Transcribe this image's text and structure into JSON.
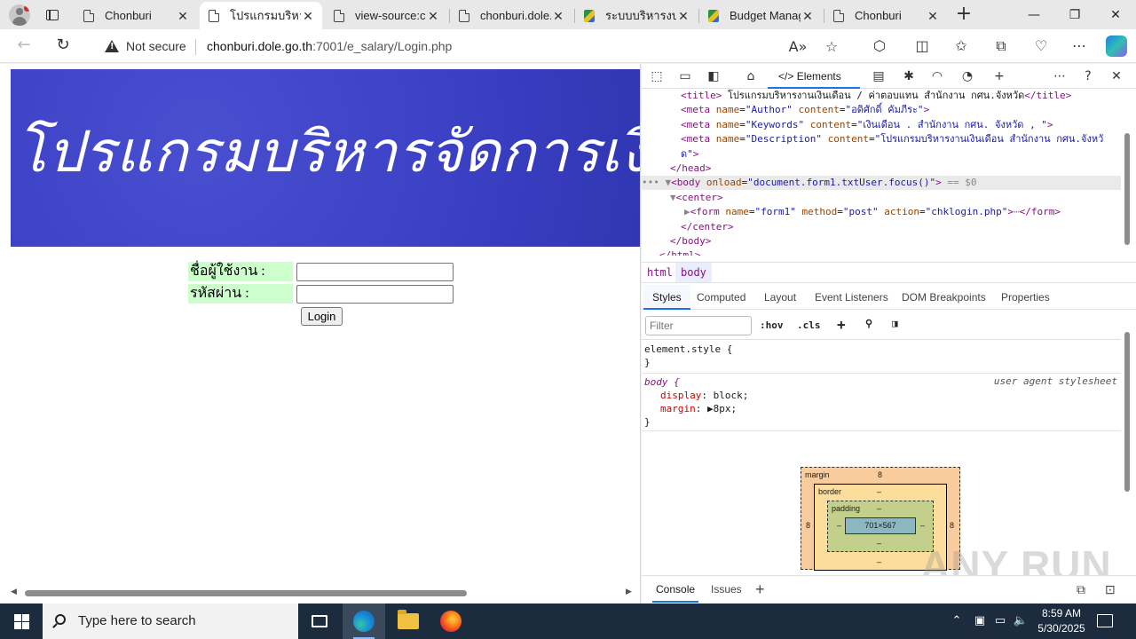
{
  "browser": {
    "tabs": [
      {
        "title": "Chonburi",
        "icon": "page-icon",
        "active": false
      },
      {
        "title": "โปรแกรมบริหารงาน",
        "icon": "page-icon",
        "active": true
      },
      {
        "title": "view-source:ch",
        "icon": "page-icon",
        "active": false
      },
      {
        "title": "chonburi.dole.g",
        "icon": "page-icon",
        "active": false
      },
      {
        "title": "ระบบบริหารงบประ",
        "icon": "image-favicon",
        "active": false
      },
      {
        "title": "Budget Manag",
        "icon": "image-favicon",
        "active": false
      },
      {
        "title": "Chonburi",
        "icon": "page-icon",
        "active": false
      }
    ],
    "address": {
      "security_label": "Not secure",
      "url_host": "chonburi.dole.go.th",
      "url_rest": ":7001/e_salary/Login.php"
    }
  },
  "page": {
    "banner_text": "โปรแกรมบริหารจัดการเงินเดือน E-Salary สำนักงาน",
    "username_label": "ชื่อผู้ใช้งาน :",
    "password_label": "รหัสผ่าน :",
    "username_value": "",
    "password_value": "",
    "login_button": "Login"
  },
  "devtools": {
    "active_tab": "Elements",
    "dom_lines": [
      {
        "html": "<span class='t'>&lt;title&gt;</span> โปรแกรมบริหารงานเงินเดือน / ค่าตอบแทน สำนักงาน กศน.จังหวัด<span class='t'>&lt;/title&gt;</span>",
        "indent": 44
      },
      {
        "html": "<span class='t'>&lt;meta</span> <span class='a'>name</span>=<span class='v'>\"Author\"</span> <span class='a'>content</span>=<span class='v'>\"อดิศักดิ์  คัมภีระ\"</span><span class='t'>&gt;</span>",
        "indent": 44
      },
      {
        "html": "<span class='t'>&lt;meta</span> <span class='a'>name</span>=<span class='v'>\"Keywords\"</span> <span class='a'>content</span>=<span class='v'>\"เงินเดือน . สำนักงาน กศน. จังหวัด , \"</span><span class='t'>&gt;</span>",
        "indent": 44
      },
      {
        "html": "<span class='t'>&lt;meta</span> <span class='a'>name</span>=<span class='v'>\"Description\"</span> <span class='a'>content</span>=<span class='v'>\"โปรแกรมบริหารงานเงินเดือน สำนักงาน กศน.จังหวั</span>",
        "indent": 44
      },
      {
        "html": "<span class='v'>ด\"</span><span class='t'>&gt;</span>",
        "indent": 44
      },
      {
        "html": "<span class='t'>&lt;/head&gt;</span>",
        "indent": 32
      },
      {
        "html": "<span class='g'>•••</span> <span class='g'>▼</span><span class='t'>&lt;body</span> <span class='a'>onload</span>=<span class='v'>\"document.form1.txtUser.focus()\"</span><span class='t'>&gt;</span> <span class='g'>== $0</span>",
        "indent": 0
      },
      {
        "html": "<span class='g'>▼</span><span class='t'>&lt;center&gt;</span>",
        "indent": 32
      },
      {
        "html": "<span class='g'>▶</span><span class='t'>&lt;form</span> <span class='a'>name</span>=<span class='v'>\"form1\"</span> <span class='a'>method</span>=<span class='v'>\"post\"</span> <span class='a'>action</span>=<span class='v'>\"chklogin.php\"</span><span class='t'>&gt;</span><span class='g'>⋯</span><span class='t'>&lt;/form&gt;</span>",
        "indent": 48
      },
      {
        "html": "<span class='t'>&lt;/center&gt;</span>",
        "indent": 44
      },
      {
        "html": "<span class='t'>&lt;/body&gt;</span>",
        "indent": 32
      },
      {
        "html": "<span class='t'>&lt;/html&gt;</span>",
        "indent": 20
      }
    ],
    "breadcrumbs": [
      "html",
      "body"
    ],
    "subtabs": [
      "Styles",
      "Computed",
      "Layout",
      "Event Listeners",
      "DOM Breakpoints",
      "Properties"
    ],
    "filter_placeholder": "Filter",
    "hov": ":hov",
    "cls": ".cls",
    "styles": {
      "element_style": "element.style {",
      "close_brace": "}",
      "body_selector": "body {",
      "ua_label": "user agent stylesheet",
      "prop1_name": "display",
      "prop1_value": "block;",
      "prop2_name": "margin",
      "prop2_value": "8px;"
    },
    "box_model": {
      "margin_label": "margin",
      "margin_value": "8",
      "border_label": "border",
      "border_value": "–",
      "padding_label": "padding",
      "padding_value": "–",
      "content_size": "701×567",
      "side_value": "8",
      "dash": "–"
    },
    "console_tabs": [
      "Console",
      "Issues"
    ]
  },
  "watermark": "ANY RUN",
  "taskbar": {
    "search_placeholder": "Type here to search",
    "time": "8:59 AM",
    "date": "5/30/2025"
  }
}
